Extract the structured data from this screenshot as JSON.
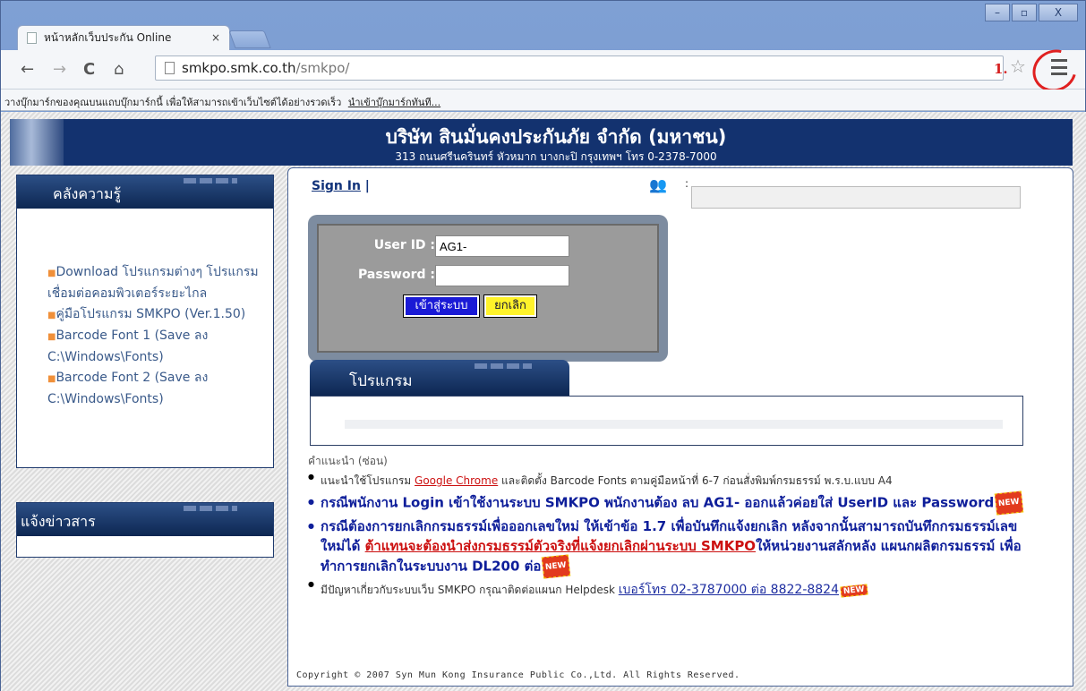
{
  "browser": {
    "tab_title": "หน้าหลักเว็บประกัน Online",
    "tab_close": "×",
    "url_host": "smkpo.smk.co.th",
    "url_path": "/smkpo/",
    "annotation_number": "1.",
    "window_buttons": [
      "–",
      "▫",
      "X"
    ],
    "bookmark_bar_text": "วางบุ๊กมาร์กของคุณบนแถบบุ๊กมาร์กนี้ เพื่อให้สามารถเข้าเว็บไซต์ได้อย่างรวดเร็ว",
    "bookmark_bar_link": "นำเข้าบุ๊กมาร์กทันที..."
  },
  "header": {
    "company": "บริษัท สินมั่นคงประกันภัย จำกัด (มหาชน)",
    "address": "313 ถนนศรีนครินทร์ หัวหมาก บางกะปิ กรุงเทพฯ โทร 0-2378-7000"
  },
  "knowledge": {
    "title": "คลังความรู้",
    "items": [
      "Download โปรแกรมต่างๆ โปรแกรมเชื่อมต่อคอมพิวเตอร์ระยะไกล",
      "คู่มือโปรแกรม SMKPO (Ver.1.50)",
      "Barcode Font 1 (Save ลง C:\\Windows\\Fonts)",
      "Barcode Font 2 (Save ลง C:\\Windows\\Fonts)"
    ]
  },
  "news": {
    "title": "แจ้งข่าวสาร"
  },
  "signin": {
    "label": "Sign In",
    "sep": "|",
    "colon": ":"
  },
  "login": {
    "userid_label": "User ID :",
    "userid_value": "AG1-",
    "password_label": "Password :",
    "password_value": "",
    "login_button": "เข้าสู่ระบบ",
    "cancel_button": "ยกเลิก"
  },
  "program": {
    "title": "โปรแกรม"
  },
  "advice": {
    "title": "คำแนะนำ (ซ่อน)",
    "line1_pre": "แนะนำใช้โปรแกรม ",
    "line1_link": "Google Chrome",
    "line1_post": " และติดตั้ง Barcode Fonts ตามคู่มือหน้าที่ 6-7 ก่อนสั่งพิมพ์กรมธรรม์ พ.ร.บ.แบบ A4",
    "line2": "กรณีพนักงาน Login เข้าใช้งานระบบ SMKPO พนักงานต้อง ลบ AG1- ออกแล้วค่อยใส่ UserID และ Password",
    "line3_pre": "กรณีต้องการยกเลิกกรมธรรม์เพื่อออกเลขใหม่ ให้เข้าข้อ 1.7 เพื่อบันทึกแจ้งยกเลิก หลังจากนั้นสามารถบันทึกกรมธรรม์เลขใหม่ได้ ",
    "line3_link": "ต้าแทนจะต้องนำส่งกรมธรรม์ตัวจริงที่แจ้งยกเลิกผ่านระบบ SMKPO",
    "line3_post": "ให้หน่วยงานสลักหลัง แผนกผลิตกรมธรรม์ เพื่อทำการยกเลิกในระบบงาน DL200 ต่อ",
    "line4_pre": "มีปัญหาเกี่ยวกับระบบเว็บ SMKPO กรุณาติดต่อแผนก Helpdesk ",
    "line4_link": "เบอร์โทร 02-3787000 ต่อ 8822-8824",
    "new_badge": "NEW"
  },
  "footer": {
    "text": "Copyright © 2007 Syn Mun Kong Insurance Public Co.,Ltd. All Rights Reserved."
  }
}
